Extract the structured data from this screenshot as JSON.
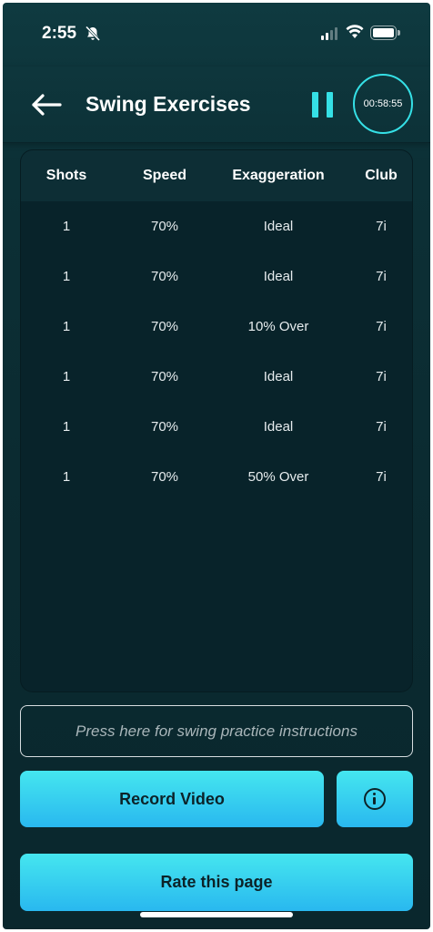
{
  "status_bar": {
    "time": "2:55"
  },
  "header": {
    "title": "Swing Exercises",
    "timer": "00:58:55"
  },
  "table": {
    "columns": [
      "Shots",
      "Speed",
      "Exaggeration",
      "Club"
    ],
    "rows": [
      [
        "1",
        "70%",
        "Ideal",
        "7i"
      ],
      [
        "1",
        "70%",
        "Ideal",
        "7i"
      ],
      [
        "1",
        "70%",
        "10% Over",
        "7i"
      ],
      [
        "1",
        "70%",
        "Ideal",
        "7i"
      ],
      [
        "1",
        "70%",
        "Ideal",
        "7i"
      ],
      [
        "1",
        "70%",
        "50% Over",
        "7i"
      ]
    ]
  },
  "instructions": {
    "label": "Press here for swing practice instructions"
  },
  "buttons": {
    "record_label": "Record Video",
    "rate_label": "Rate this page",
    "info_icon": "info-icon"
  },
  "colors": {
    "accent": "#35e0e6",
    "button_top": "#45e6ef",
    "button_bottom": "#29b8ef",
    "background": "#0b2b31"
  }
}
